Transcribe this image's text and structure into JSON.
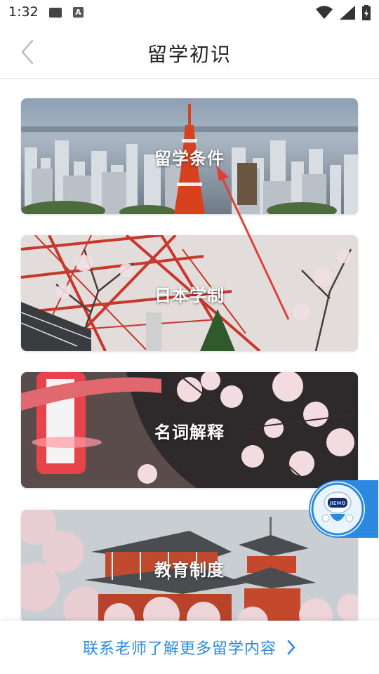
{
  "status_bar": {
    "time": "1:32",
    "icons": [
      "image-icon",
      "a-icon",
      "wifi-icon",
      "signal-icon",
      "battery-icon"
    ]
  },
  "header": {
    "title": "留学初识",
    "back_icon": "chevron-left-icon"
  },
  "cards": [
    {
      "label": "留学条件",
      "theme": "tokyo-tower-skyline"
    },
    {
      "label": "日本学制",
      "theme": "red-tower-cherry-branches"
    },
    {
      "label": "名词解释",
      "theme": "lantern-cherry-blossoms"
    },
    {
      "label": "教育制度",
      "theme": "pagoda-cherry-blossoms"
    }
  ],
  "floating_assistant": {
    "badge_text": "JIEMO",
    "icon": "robot-avatar-icon"
  },
  "footer": {
    "link_text": "联系老师了解更多留学内容",
    "chevron": "chevron-right-icon"
  },
  "colors": {
    "accent": "#2b8ae0",
    "annotation_arrow": "#e0403a"
  }
}
